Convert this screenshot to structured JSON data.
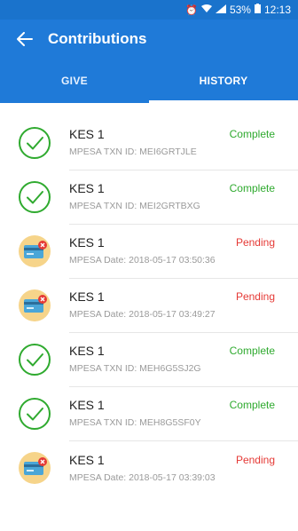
{
  "status_bar": {
    "battery": "53%",
    "time": "12:13"
  },
  "header": {
    "title": "Contributions"
  },
  "tabs": [
    {
      "label": "GIVE",
      "active": false
    },
    {
      "label": "HISTORY",
      "active": true
    }
  ],
  "transactions": [
    {
      "amount": "KES 1",
      "status": "Complete",
      "detail": "MPESA TXN ID: MEI6GRTJLE",
      "icon": "check-circle-icon"
    },
    {
      "amount": "KES 1",
      "status": "Complete",
      "detail": "MPESA TXN ID: MEI2GRTBXG",
      "icon": "check-circle-icon"
    },
    {
      "amount": "KES 1",
      "status": "Pending",
      "detail": "MPESA Date: 2018-05-17 03:50:36",
      "icon": "pending-card-icon"
    },
    {
      "amount": "KES 1",
      "status": "Pending",
      "detail": "MPESA Date: 2018-05-17 03:49:27",
      "icon": "pending-card-icon"
    },
    {
      "amount": "KES 1",
      "status": "Complete",
      "detail": "MPESA TXN ID: MEH6G5SJ2G",
      "icon": "check-circle-icon"
    },
    {
      "amount": "KES 1",
      "status": "Complete",
      "detail": "MPESA TXN ID: MEH8G5SF0Y",
      "icon": "check-circle-icon"
    },
    {
      "amount": "KES 1",
      "status": "Pending",
      "detail": "MPESA Date: 2018-05-17 03:39:03",
      "icon": "pending-card-icon"
    }
  ],
  "colors": {
    "primary": "#1f7ad8",
    "complete": "#2faa2f",
    "pending": "#e53935"
  }
}
